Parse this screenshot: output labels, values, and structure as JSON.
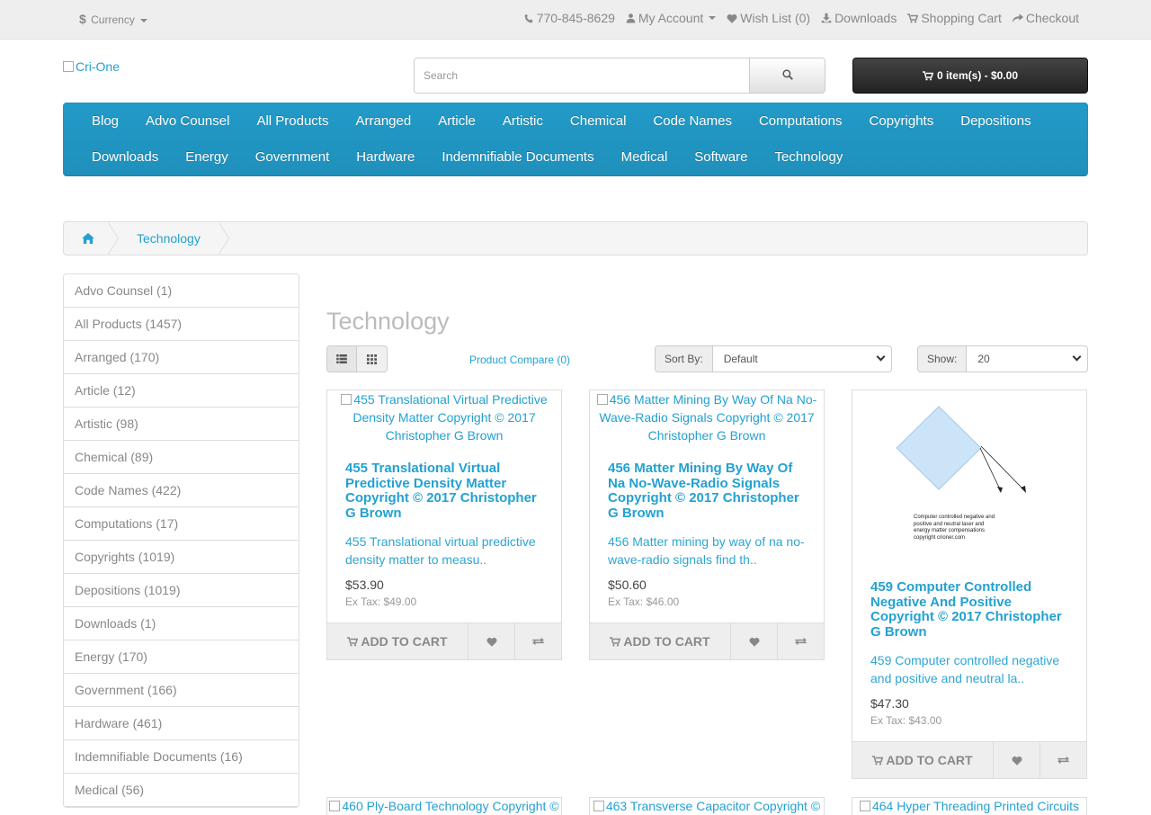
{
  "topbar": {
    "currency_symbol": "$",
    "currency_label": "Currency",
    "phone": "770-845-8629",
    "my_account": "My Account",
    "wish_list": "Wish List (0)",
    "downloads": "Downloads",
    "shopping_cart": "Shopping Cart",
    "checkout": "Checkout"
  },
  "header": {
    "logo_alt": "Cri-One",
    "search_placeholder": "Search",
    "cart_total": "0 item(s) - $0.00"
  },
  "menu": {
    "items": [
      "Blog",
      "Advo Counsel",
      "All Products",
      "Arranged",
      "Article",
      "Artistic",
      "Chemical",
      "Code Names",
      "Computations",
      "Copyrights",
      "Depositions",
      "Downloads",
      "Energy",
      "Government",
      "Hardware",
      "Indemnifiable Documents",
      "Medical",
      "Software",
      "Technology"
    ]
  },
  "breadcrumb": {
    "current": "Technology"
  },
  "sidebar": {
    "categories": [
      "Advo Counsel (1)",
      "All Products (1457)",
      "Arranged (170)",
      "Article (12)",
      "Artistic (98)",
      "Chemical (89)",
      "Code Names (422)",
      "Computations (17)",
      "Copyrights (1019)",
      "Depositions (1019)",
      "Downloads (1)",
      "Energy (170)",
      "Government (166)",
      "Hardware (461)",
      "Indemnifiable Documents (16)",
      "Medical (56)"
    ]
  },
  "content": {
    "title": "Technology",
    "product_compare": "Product Compare (0)",
    "sort_label": "Sort By:",
    "sort_value": "Default",
    "show_label": "Show:",
    "show_value": "20"
  },
  "products": [
    {
      "img_alt": "455 Translational Virtual Predictive Density Matter Copyright © 2017 Christopher G Brown",
      "name": "455 Translational Virtual Predictive Density Matter Copyright © 2017 Christopher G Brown",
      "desc": "455 Translational virtual predictive density matter to measu..",
      "price": "$53.90",
      "tax": "Ex Tax: $49.00",
      "add_label": "ADD TO CART"
    },
    {
      "img_alt": "456 Matter Mining By Way Of Na No-Wave-Radio Signals Copyright © 2017 Christopher G Brown",
      "name": "456 Matter Mining By Way Of Na No-Wave-Radio Signals Copyright © 2017 Christopher G Brown",
      "desc": "456 Matter mining by way of na no-wave-radio signals find th..",
      "price": "$50.60",
      "tax": "Ex Tax: $46.00",
      "add_label": "ADD TO CART"
    },
    {
      "img_caption": "Computer controlled negative and positive and neutral laser and energy matter compensations copyright crioner.com",
      "name": "459 Computer Controlled Negative And Positive Copyright © 2017 Christopher G Brown",
      "desc": "459 Computer controlled negative and positive and neutral la..",
      "price": "$47.30",
      "tax": "Ex Tax: $43.00",
      "add_label": "ADD TO CART"
    }
  ],
  "next_row": [
    "460 Ply-Board Technology Copyright ©",
    "463 Transverse Capacitor Copyright ©",
    "464 Hyper Threading Printed Circuits"
  ]
}
